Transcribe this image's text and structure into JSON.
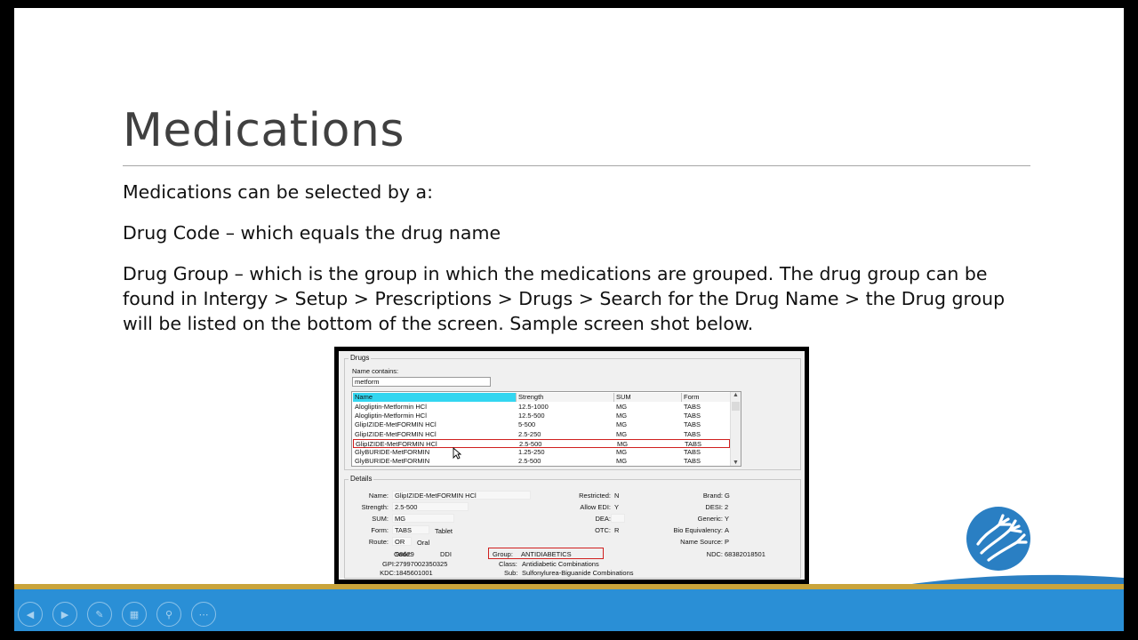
{
  "slide": {
    "title": "Medications",
    "p1": "Medications can be selected by a:",
    "p2": "Drug Code – which equals the drug name",
    "p3": "Drug Group – which is the group in which the medications are grouped. The drug group can be found in Intergy > Setup > Prescriptions > Drugs > Search for the Drug Name > the Drug group will be listed on the bottom of the screen.  Sample screen shot below."
  },
  "drugs_panel": {
    "group_title": "Drugs",
    "name_contains_label": "Name contains:",
    "search_value": "metform",
    "columns": [
      "Name",
      "Strength",
      "SUM",
      "Form"
    ],
    "rows": [
      [
        "Alogliptin-Metformin HCl",
        "12.5-1000",
        "MG",
        "TABS"
      ],
      [
        "Alogliptin-Metformin HCl",
        "12.5-500",
        "MG",
        "TABS"
      ],
      [
        "GlipIZIDE-MetFORMIN HCl",
        "5-500",
        "MG",
        "TABS"
      ],
      [
        "GlipIZIDE-MetFORMIN HCl",
        "2.5-250",
        "MG",
        "TABS"
      ],
      [
        "GlipIZIDE-MetFORMIN HCl",
        "2.5-500",
        "MG",
        "TABS"
      ],
      [
        "GlyBURIDE-MetFORMIN",
        "1.25-250",
        "MG",
        "TABS"
      ],
      [
        "GlyBURIDE-MetFORMIN",
        "2.5-500",
        "MG",
        "TABS"
      ]
    ],
    "selected_row_index": 4
  },
  "details": {
    "group_title": "Details",
    "name_label": "Name:",
    "name_value": "GlipIZIDE-MetFORMIN HCl",
    "strength_label": "Strength:",
    "strength_value": "2.5-500",
    "sum_label": "SUM:",
    "sum_value": "MG",
    "form_label": "Form:",
    "form_value": "TABS",
    "form_desc": "Tablet",
    "route_label": "Route:",
    "route_value": "OR",
    "route_desc": "Oral",
    "restricted_label": "Restricted:",
    "restricted_value": "N",
    "allow_edi_label": "Allow EDI:",
    "allow_edi_value": "Y",
    "dea_label": "DEA:",
    "dea_value": "",
    "otc_label": "OTC:",
    "otc_value": "R",
    "brand_label": "Brand:",
    "brand_value": "G",
    "desi_label": "DESI:",
    "desi_value": "2",
    "generic_label": "Generic:",
    "generic_value": "Y",
    "bio_label": "Bio Equivalency:",
    "bio_value": "A",
    "name_source_label": "Name Source:",
    "name_source_value": "P",
    "code_label": "Code:",
    "code_value": "98629",
    "ddi_label": "DDI",
    "group_label": "Group:",
    "group_value": "ANTIDIABETICS",
    "ndc_label": "NDC:",
    "ndc_value": "68382018501",
    "gpi_label": "GPI:",
    "gpi_value": "27997002350325",
    "class_label": "Class:",
    "class_value": "Antidiabetic Combinations",
    "kdc_label": "KDC:",
    "kdc_value": "1845601001",
    "sub_label": "Sub:",
    "sub_value": "Sulfonylurea-Biguanide Combinations"
  },
  "nav_icons": [
    "previous-icon",
    "next-icon",
    "pen-icon",
    "slides-icon",
    "zoom-icon",
    "more-icon"
  ],
  "colors": {
    "gold_band": "#c9a43b",
    "blue_band": "#2a8fd6",
    "highlight_red": "#d0201f",
    "header_cyan": "#33d6f0"
  }
}
